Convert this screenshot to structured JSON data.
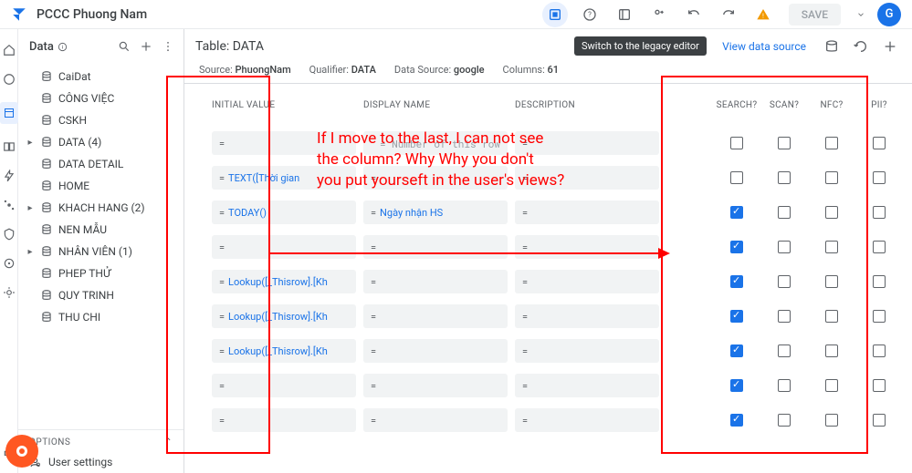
{
  "header": {
    "app_name": "PCCC Phuong Nam",
    "save_label": "SAVE",
    "avatar_letter": "G",
    "tooltip": "Switch to the legacy editor"
  },
  "sidebar": {
    "title": "Data",
    "items": [
      {
        "label": "CaiDat",
        "caret": ""
      },
      {
        "label": "CÔNG VIỆC",
        "caret": ""
      },
      {
        "label": "CSKH",
        "caret": ""
      },
      {
        "label": "DATA (4)",
        "caret": "▸"
      },
      {
        "label": "DATA DETAIL",
        "caret": ""
      },
      {
        "label": "HOME",
        "caret": ""
      },
      {
        "label": "KHACH HANG (2)",
        "caret": "▸"
      },
      {
        "label": "NEN MẪU",
        "caret": ""
      },
      {
        "label": "NHÂN VIÊN (1)",
        "caret": "▸"
      },
      {
        "label": "PHEP THỬ",
        "caret": ""
      },
      {
        "label": "QUY TRINH",
        "caret": ""
      },
      {
        "label": "THU CHI",
        "caret": ""
      }
    ],
    "options_label": "OPTIONS",
    "user_settings": "User settings"
  },
  "content": {
    "title": "Table: DATA",
    "view_data_source": "View data source",
    "meta": {
      "source_l": "Source:",
      "source_v": "PhuongNam",
      "qual_l": "Qualifier:",
      "qual_v": "DATA",
      "ds_l": "Data Source:",
      "ds_v": "google",
      "cols_l": "Columns:",
      "cols_v": "61"
    },
    "columns": [
      "INITIAL VALUE",
      "DISPLAY NAME",
      "DESCRIPTION",
      "SEARCH?",
      "SCAN?",
      "NFC?",
      "PII?"
    ],
    "rows": [
      {
        "iv": "",
        "dn_ghost": "= Number of this row",
        "desc": "",
        "search": false,
        "scan": false,
        "nfc": false,
        "pii": false
      },
      {
        "iv": "TEXT([Thời gian",
        "dn": "",
        "desc": "",
        "search": false,
        "scan": false,
        "nfc": false,
        "pii": false
      },
      {
        "iv": "TODAY()",
        "dn": "Ngày nhận HS",
        "desc": "",
        "search": true,
        "scan": false,
        "nfc": false,
        "pii": false
      },
      {
        "iv": "",
        "dn": "",
        "desc": "",
        "search": true,
        "scan": false,
        "nfc": false,
        "pii": false
      },
      {
        "iv": "Lookup([_Thisrow].[Kh",
        "dn": "",
        "desc": "",
        "search": true,
        "scan": false,
        "nfc": false,
        "pii": false
      },
      {
        "iv": "Lookup([_Thisrow].[Kh",
        "dn": "",
        "desc": "",
        "search": true,
        "scan": false,
        "nfc": false,
        "pii": false
      },
      {
        "iv": "Lookup([_Thisrow].[Kh",
        "dn": "",
        "desc": "",
        "search": true,
        "scan": false,
        "nfc": false,
        "pii": false
      },
      {
        "iv": "",
        "dn": "",
        "desc": "",
        "search": true,
        "scan": false,
        "nfc": false,
        "pii": false
      },
      {
        "iv": "",
        "dn": "",
        "desc": "",
        "search": true,
        "scan": false,
        "nfc": false,
        "pii": false
      }
    ]
  },
  "annotation": {
    "text": "If I move to the last, I can not see\nthe column? Why Why you don't\nyou put yourseft in the user's views?"
  }
}
